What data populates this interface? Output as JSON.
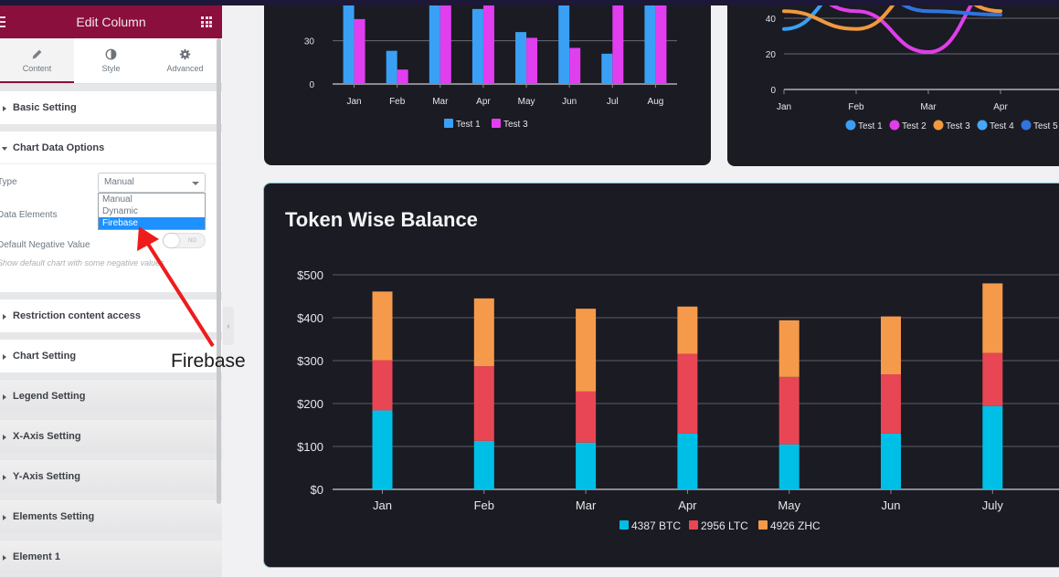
{
  "panel": {
    "title": "Edit Column",
    "tabs": [
      {
        "label": "Content",
        "icon": "pencil-icon",
        "active": true
      },
      {
        "label": "Style",
        "icon": "contrast-icon",
        "active": false
      },
      {
        "label": "Advanced",
        "icon": "gear-icon",
        "active": false
      }
    ],
    "sections_before": [
      {
        "label": "Basic Setting"
      }
    ],
    "open_section": {
      "label": "Chart Data Options",
      "type_label": "Type",
      "type_value": "Manual",
      "type_options": [
        "Manual",
        "Dynamic",
        "Firebase"
      ],
      "type_highlighted": "Firebase",
      "data_elements_label": "Data Elements",
      "negative_label": "Default Negative Value",
      "negative_toggle": "NO",
      "negative_hint": "Show default chart with some negative values"
    },
    "sections_after": [
      {
        "label": "Restriction content access"
      },
      {
        "label": "Chart Setting"
      },
      {
        "label": "Legend Setting"
      },
      {
        "label": "X-Axis Setting"
      },
      {
        "label": "Y-Axis Setting"
      },
      {
        "label": "Elements Setting"
      },
      {
        "label": "Element 1"
      }
    ],
    "collapse_icon": "chevron-left-icon"
  },
  "annotation": {
    "text": "Firebase",
    "color": "#ee1c1c"
  },
  "chart_data": [
    {
      "type": "bar",
      "title": "",
      "categories": [
        "Jan",
        "Feb",
        "Mar",
        "Apr",
        "May",
        "Jun",
        "Jul",
        "Aug"
      ],
      "series": [
        {
          "name": "Test 1",
          "color": "#3aa0f5",
          "values": [
            60,
            23,
            60,
            52,
            36,
            60,
            21,
            60
          ]
        },
        {
          "name": "Test 3",
          "color": "#e13ef0",
          "values": [
            45,
            10,
            60,
            60,
            32,
            25,
            60,
            60
          ]
        }
      ],
      "yticks": [
        "0",
        "30"
      ],
      "ylim": [
        0,
        60
      ],
      "note": "values above ~57 are cropped at the top of the screenshot",
      "legend": "bottom"
    },
    {
      "type": "line",
      "title": "",
      "categories": [
        "Jan",
        "Feb",
        "Mar",
        "Apr"
      ],
      "series": [
        {
          "name": "Test 1",
          "color": "#3aa0f5",
          "values": [
            34,
            60,
            60,
            60
          ]
        },
        {
          "name": "Test 2",
          "color": "#df3ee8",
          "values": [
            60,
            44,
            21,
            60
          ]
        },
        {
          "name": "Test 3",
          "color": "#f0993f",
          "values": [
            44,
            34,
            60,
            44
          ]
        },
        {
          "name": "Test 4",
          "color": "#46a8f8",
          "values": [
            60,
            60,
            60,
            60
          ]
        },
        {
          "name": "Test 5",
          "color": "#2f74e0",
          "values": [
            60,
            60,
            44,
            42
          ]
        }
      ],
      "yticks": [
        "0",
        "20",
        "40"
      ],
      "ylim": [
        0,
        50
      ],
      "legend": "bottom"
    },
    {
      "type": "bar",
      "stacked": true,
      "title": "Token Wise Balance",
      "categories": [
        "Jan",
        "Feb",
        "Mar",
        "Apr",
        "May",
        "Jun",
        "July"
      ],
      "series": [
        {
          "name": "4387 BTC",
          "color": "#00bfe6",
          "values": [
            184,
            113,
            109,
            130,
            105,
            130,
            194
          ]
        },
        {
          "name": "2956 LTC",
          "color": "#e84654",
          "values": [
            117,
            174,
            119,
            186,
            157,
            138,
            124
          ]
        },
        {
          "name": "4926 ZHC",
          "color": "#f59a4a",
          "values": [
            160,
            158,
            193,
            110,
            132,
            135,
            162
          ]
        }
      ],
      "yticks": [
        "$0",
        "$100",
        "$200",
        "$300",
        "$400",
        "$500"
      ],
      "ylim": [
        0,
        500
      ],
      "grid": true,
      "legend": "bottom"
    }
  ]
}
